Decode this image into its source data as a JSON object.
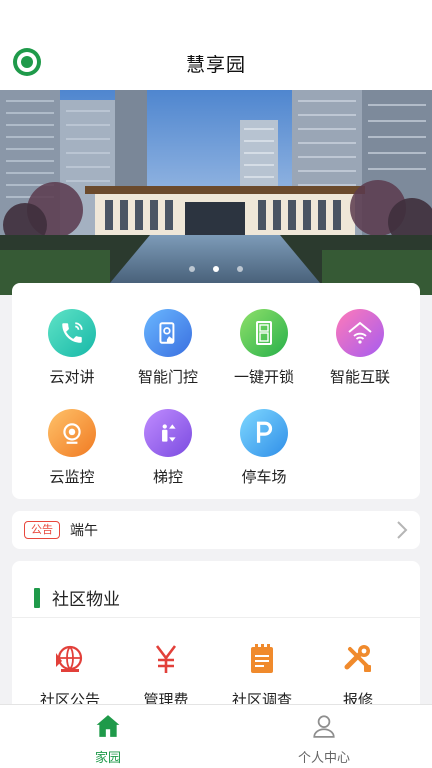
{
  "header": {
    "title": "慧享园"
  },
  "banner": {
    "slide_count": 3,
    "active_slide": 2
  },
  "menu": {
    "items": [
      {
        "label": "云对讲",
        "icon": "phone-icon"
      },
      {
        "label": "智能门控",
        "icon": "door-control-icon"
      },
      {
        "label": "一键开锁",
        "icon": "door-unlock-icon"
      },
      {
        "label": "智能互联",
        "icon": "smart-home-icon"
      },
      {
        "label": "云监控",
        "icon": "camera-icon"
      },
      {
        "label": "梯控",
        "icon": "elevator-icon"
      },
      {
        "label": "停车场",
        "icon": "parking-icon"
      }
    ]
  },
  "notice": {
    "tag": "公告",
    "text": "端午"
  },
  "community": {
    "title": "社区物业",
    "items": [
      {
        "label": "社区公告",
        "icon": "announcement-icon"
      },
      {
        "label": "管理费",
        "icon": "yuan-icon"
      },
      {
        "label": "社区调查",
        "icon": "survey-icon"
      },
      {
        "label": "报修",
        "icon": "repair-icon"
      }
    ]
  },
  "bottom_nav": {
    "items": [
      {
        "label": "家园",
        "icon": "home-icon",
        "active": true
      },
      {
        "label": "个人中心",
        "icon": "user-icon",
        "active": false
      }
    ]
  },
  "colors": {
    "brand_green": "#1f9a4a",
    "notice_red": "#e8473c"
  }
}
